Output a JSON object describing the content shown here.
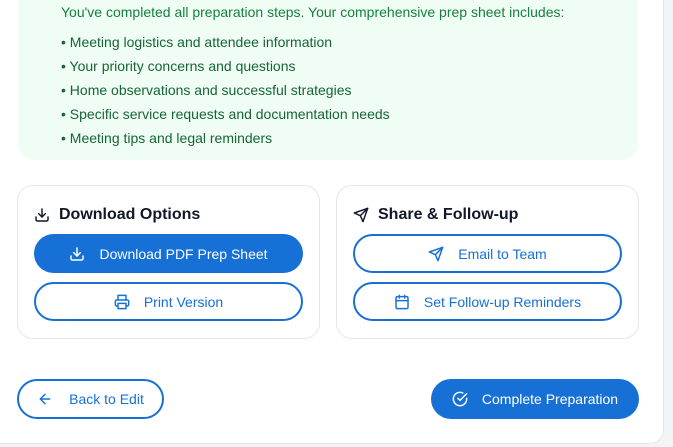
{
  "summary": {
    "intro": "You've completed all preparation steps. Your comprehensive prep sheet includes:",
    "items": [
      "Meeting logistics and attendee information",
      "Your priority concerns and questions",
      "Home observations and successful strategies",
      "Specific service requests and documentation needs",
      "Meeting tips and legal reminders"
    ]
  },
  "download": {
    "title": "Download Options",
    "title_icon": "download-icon",
    "pdf_label": "Download PDF Prep Sheet",
    "pdf_icon": "download-icon",
    "print_label": "Print Version",
    "print_icon": "printer-icon"
  },
  "share": {
    "title": "Share & Follow-up",
    "title_icon": "send-icon",
    "email_label": "Email to Team",
    "email_icon": "send-icon",
    "reminder_label": "Set Follow-up Reminders",
    "reminder_icon": "calendar-icon"
  },
  "footer": {
    "back_label": "Back to Edit",
    "back_icon": "arrow-left-icon",
    "complete_label": "Complete Preparation",
    "complete_icon": "check-circle-icon"
  },
  "colors": {
    "primary": "#1670d6",
    "success_bg": "#f0fdf4",
    "success_text": "#166534"
  }
}
